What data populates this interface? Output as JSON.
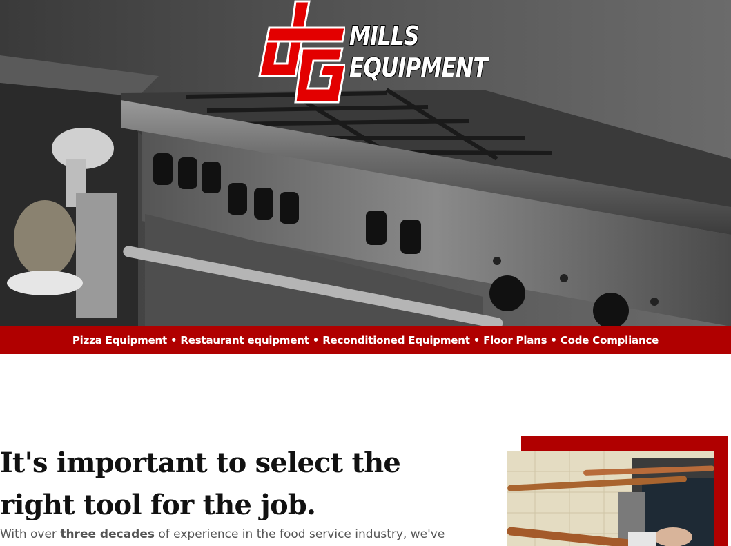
{
  "brand": {
    "name_line1": "MILLS",
    "name_line2": "EQUIPMENT",
    "logo_colors": {
      "red": "#e30000",
      "outline": "#ffffff"
    }
  },
  "tagline": "Pizza Equipment • Restaurant equipment • Reconditioned Equipment • Floor Plans • Code Compliance",
  "main": {
    "headline": "It's important to select the right tool for the job.",
    "intro_prefix": "With over ",
    "intro_bold": "three decades",
    "intro_suffix": " of experience in the food service industry, we've"
  },
  "colors": {
    "accent_red": "#b00000",
    "text_dark": "#111111",
    "text_muted": "#555555"
  }
}
